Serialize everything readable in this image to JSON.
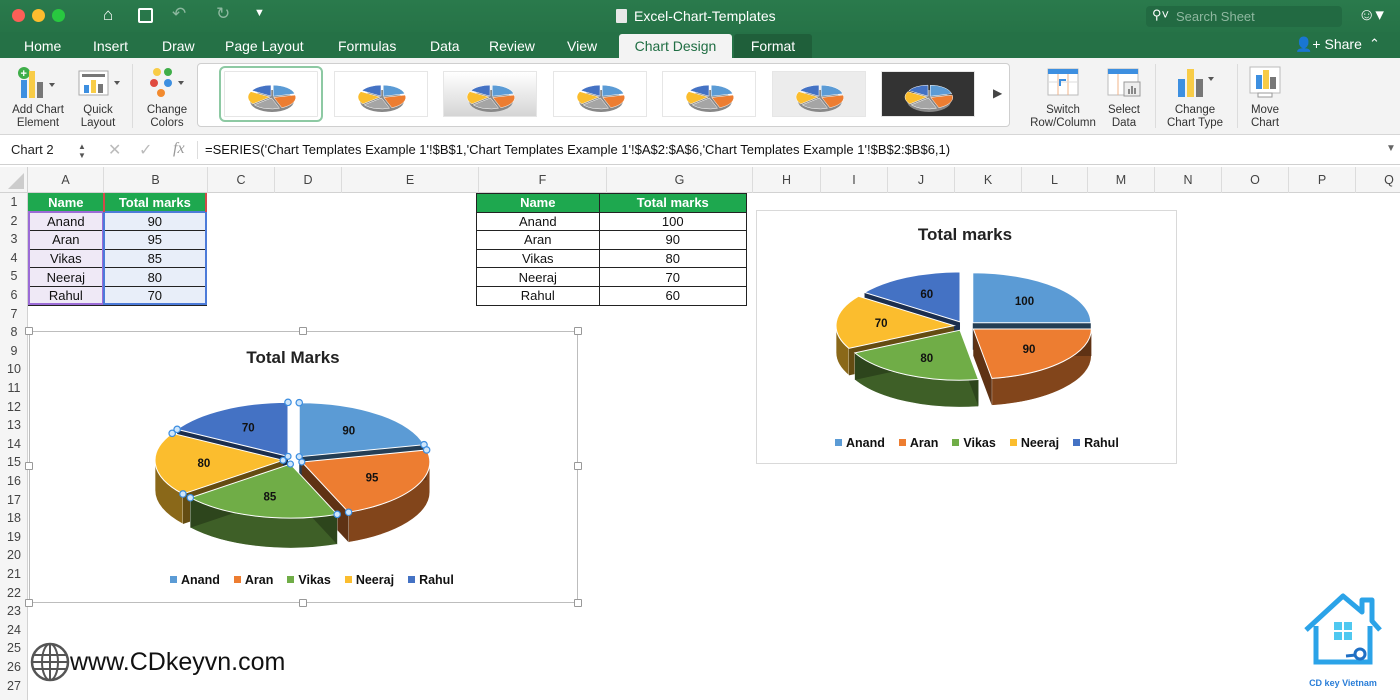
{
  "window": {
    "title": "Excel-Chart-Templates",
    "search_placeholder": "Search Sheet"
  },
  "ribbon_tabs": [
    {
      "label": "Home"
    },
    {
      "label": "Insert"
    },
    {
      "label": "Draw"
    },
    {
      "label": "Page Layout"
    },
    {
      "label": "Formulas"
    },
    {
      "label": "Data"
    },
    {
      "label": "Review"
    },
    {
      "label": "View"
    },
    {
      "label": "Chart Design",
      "active": true
    },
    {
      "label": "Format"
    }
  ],
  "share_label": "Share",
  "ribbon": {
    "add_chart_element": [
      "Add Chart",
      "Element"
    ],
    "quick_layout": [
      "Quick",
      "Layout"
    ],
    "change_colors": [
      "Change",
      "Colors"
    ],
    "switch_row_column": [
      "Switch",
      "Row/Column"
    ],
    "select_data": [
      "Select",
      "Data"
    ],
    "change_chart_type": [
      "Change",
      "Chart Type"
    ],
    "move_chart": [
      "Move",
      "Chart"
    ],
    "chart_styles_count": 7,
    "selected_style_index": 0
  },
  "formula_bar": {
    "name_box": "Chart 2",
    "formula": "=SERIES('Chart Templates Example 1'!$B$1,'Chart Templates Example 1'!$A$2:$A$6,'Chart Templates Example 1'!$B$2:$B$6,1)"
  },
  "columns": [
    "A",
    "B",
    "C",
    "D",
    "E",
    "F",
    "G",
    "H",
    "I",
    "J",
    "K",
    "L",
    "M",
    "N",
    "O",
    "P",
    "Q"
  ],
  "rows": [
    "1",
    "2",
    "3",
    "4",
    "5",
    "6",
    "7",
    "8",
    "9",
    "10",
    "11",
    "12",
    "13",
    "14",
    "15",
    "16",
    "17",
    "18",
    "19",
    "20",
    "21",
    "22",
    "23",
    "24",
    "25",
    "26",
    "27"
  ],
  "table1": {
    "headers": [
      "Name",
      "Total marks"
    ],
    "rows": [
      [
        "Anand",
        "90"
      ],
      [
        "Aran",
        "95"
      ],
      [
        "Vikas",
        "85"
      ],
      [
        "Neeraj",
        "80"
      ],
      [
        "Rahul",
        "70"
      ]
    ]
  },
  "table2": {
    "headers": [
      "Name",
      "Total marks"
    ],
    "rows": [
      [
        "Anand",
        "100"
      ],
      [
        "Aran",
        "90"
      ],
      [
        "Vikas",
        "80"
      ],
      [
        "Neeraj",
        "70"
      ],
      [
        "Rahul",
        "60"
      ]
    ]
  },
  "colors": {
    "excel_green": "#217346",
    "header_fill": "#1ea84f",
    "Anand": "#5b9bd5",
    "Aran": "#ed7d31",
    "Vikas": "#70ad47",
    "Neeraj": "#fbbd2e",
    "Rahul": "#4472c4"
  },
  "chart_data": [
    {
      "type": "pie",
      "variant": "3d-exploded",
      "title": "Total Marks",
      "categories": [
        "Anand",
        "Aran",
        "Vikas",
        "Neeraj",
        "Rahul"
      ],
      "values": [
        90,
        95,
        85,
        80,
        70
      ],
      "data_labels": [
        "90",
        "95",
        "85",
        "80",
        "70"
      ],
      "legend": "bottom",
      "selected": true
    },
    {
      "type": "pie",
      "variant": "3d-exploded",
      "title": "Total marks",
      "categories": [
        "Anand",
        "Aran",
        "Vikas",
        "Neeraj",
        "Rahul"
      ],
      "values": [
        100,
        90,
        80,
        70,
        60
      ],
      "data_labels": [
        "100",
        "90",
        "80",
        "70",
        "60"
      ],
      "legend": "bottom"
    }
  ],
  "watermark": {
    "text": "www.CDkeyvn.com",
    "logo_caption": "CD key Vietnam"
  }
}
